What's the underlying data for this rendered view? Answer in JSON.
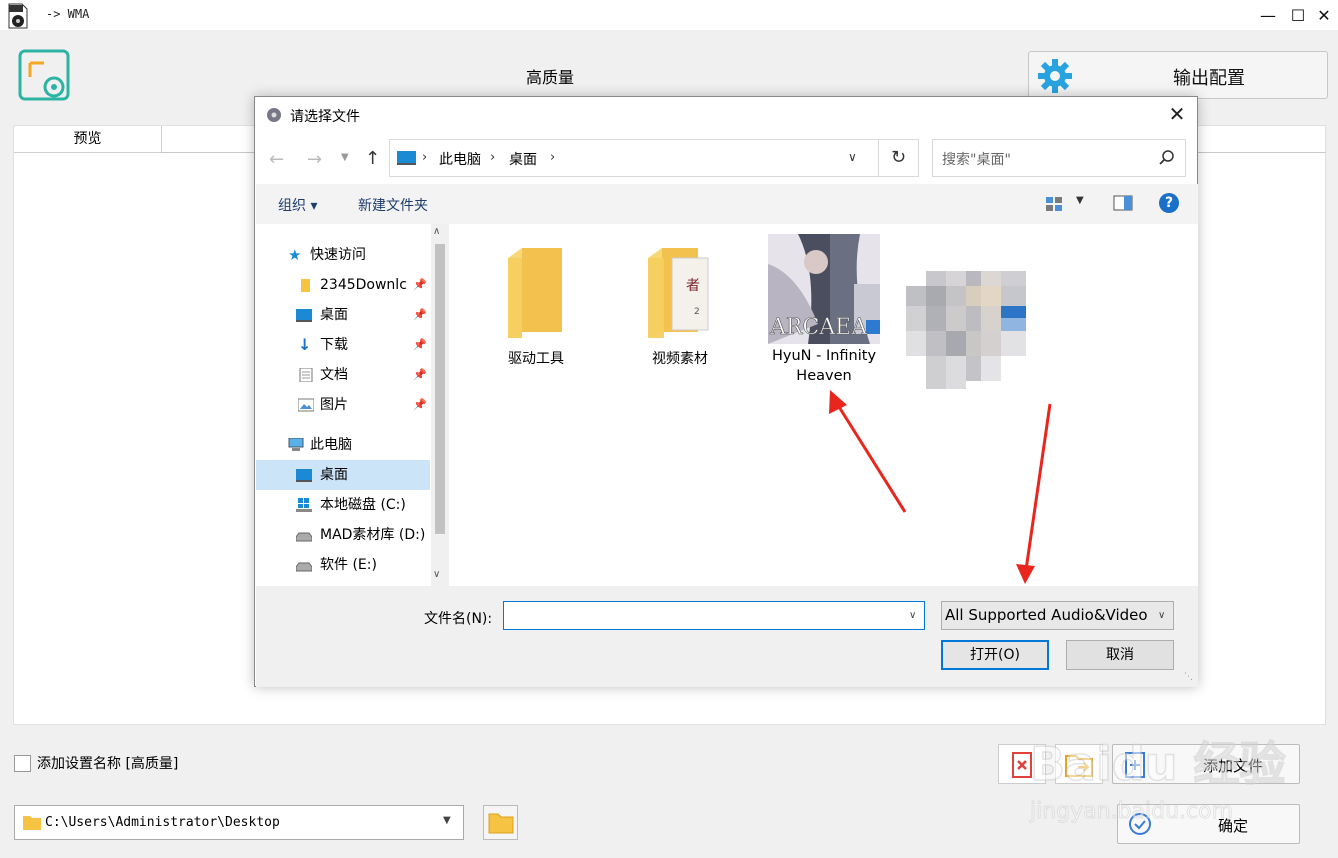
{
  "app": {
    "title": "-> WMA",
    "preset_label": "高质量",
    "output_config_label": "输出配置",
    "preview_column": "预览",
    "add_name_checkbox_label": "添加设置名称 [高质量]",
    "add_name_checked": false,
    "add_file_label": "添加文件",
    "confirm_label": "确定",
    "output_path": "C:\\Users\\Administrator\\Desktop"
  },
  "dialog": {
    "title": "请选择文件",
    "breadcrumb": [
      "此电脑",
      "桌面"
    ],
    "search_placeholder": "搜索\"桌面\"",
    "commands": {
      "organize": "组织 ▾",
      "new_folder": "新建文件夹"
    },
    "help": "?",
    "nav_items": [
      {
        "label": "快速访问",
        "icon": "star-icon",
        "pinned": false
      },
      {
        "label": "2345Downlc",
        "icon": "folder-icon",
        "pinned": true
      },
      {
        "label": "桌面",
        "icon": "desktop-icon",
        "pinned": true
      },
      {
        "label": "下载",
        "icon": "download-icon",
        "pinned": true
      },
      {
        "label": "文档",
        "icon": "document-icon",
        "pinned": true
      },
      {
        "label": "图片",
        "icon": "picture-icon",
        "pinned": true
      },
      {
        "label": "此电脑",
        "icon": "computer-icon",
        "pinned": false
      },
      {
        "label": "桌面",
        "icon": "desktop-icon",
        "pinned": false,
        "selected": true
      },
      {
        "label": "本地磁盘 (C:)",
        "icon": "drive-icon",
        "pinned": false
      },
      {
        "label": "MAD素材库 (D:)",
        "icon": "drive-icon",
        "pinned": false
      },
      {
        "label": "软件 (E:)",
        "icon": "drive-icon",
        "pinned": false
      }
    ],
    "files": [
      {
        "name": "驱动工具",
        "type": "folder"
      },
      {
        "name": "视频素材",
        "type": "folder"
      },
      {
        "name": "HyuN - Infinity Heaven",
        "type": "media-thumbnail",
        "thumbnail_text": "ARCAEA"
      },
      {
        "name": "",
        "type": "pixelated-thumbnail"
      }
    ],
    "filename_label": "文件名(N):",
    "filename_value": "",
    "filetype_value": "All Supported Audio&Video",
    "open_label": "打开(O)",
    "cancel_label": "取消"
  },
  "watermark": {
    "brand": "Baidu 经验",
    "url": "jingyan.baidu.com"
  },
  "colors": {
    "accent": "#0078d7",
    "logo_teal": "#2bb3a4",
    "gear_blue": "#29a3df",
    "arrow_red": "#e8261d"
  }
}
